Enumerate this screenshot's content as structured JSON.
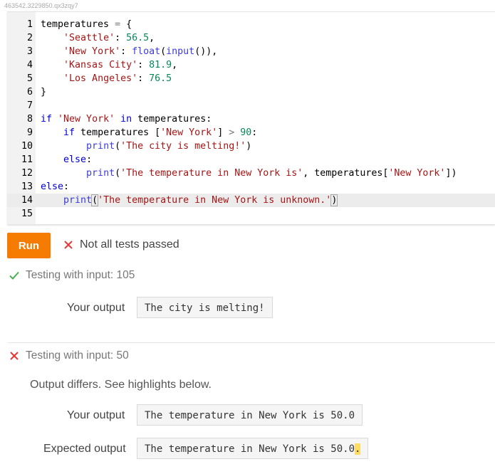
{
  "ref_code": "463542.3229850.qx3zqy7",
  "editor": {
    "line_numbers": [
      "1",
      "2",
      "3",
      "4",
      "5",
      "6",
      "7",
      "8",
      "9",
      "10",
      "11",
      "12",
      "13",
      "14",
      "15"
    ]
  },
  "run_label": "Run",
  "status_text": "Not all tests passed",
  "test1": {
    "title": "Testing with input: 105",
    "your_output_label": "Your output",
    "your_output": "The city is melting!"
  },
  "test2": {
    "title": "Testing with input: 50",
    "message": "Output differs. See highlights below.",
    "your_output_label": "Your output",
    "your_output": "The temperature in New York is 50.0",
    "expected_label": "Expected output",
    "expected_prefix": "The temperature in New York is 50.0",
    "expected_highlight": "."
  },
  "colors": {
    "run_button": "#f57c00",
    "pass": "#4caf50",
    "fail": "#e53935",
    "highlight": "#fddc64"
  }
}
